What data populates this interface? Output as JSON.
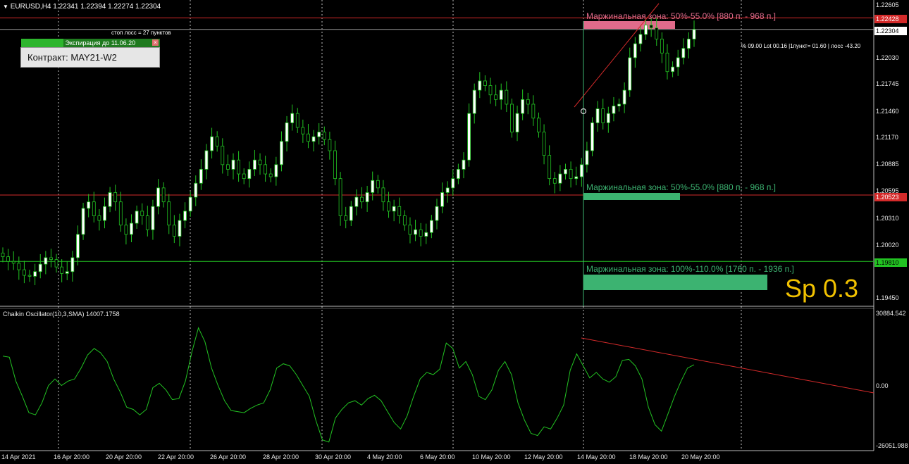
{
  "chart_header": {
    "symbol_line": "EURUSD,H4  1.22341 1.22394 1.22274 1.22304",
    "menu_glyph": "▼"
  },
  "overlay": {
    "stop_loss_text": "стоп лосс = 27 пунктов",
    "expiry_text": "Экспирация до 11.06.20",
    "contract_label": "Контракт: MAY21-W2",
    "spread_label": "Sp 0.3",
    "position_info": "% 09.00  Lot 00.16  |1пункт= 01.60  | лосс -43.20"
  },
  "zones": [
    {
      "label": "Маржинальная зона: 50%-55.0% [880 п. - 968 п.]",
      "color": "#e06b8b"
    },
    {
      "label": "Маржинальная зона: 50%-55.0% [880 п. - 968 п.]",
      "color": "#3cb371"
    },
    {
      "label": "Маржинальная зона: 100%-110.0% [1760 п. - 1936 п.]",
      "color": "#3cb371"
    }
  ],
  "price_axis": {
    "ticks": [
      "1.22605",
      "1.22030",
      "1.21745",
      "1.21460",
      "1.21170",
      "1.20885",
      "1.20595",
      "1.20310",
      "1.20020",
      "1.19450"
    ],
    "tags": [
      {
        "value": "1.22428",
        "bg": "#d42a2a",
        "fg": "#ffffff"
      },
      {
        "value": "1.22304",
        "bg": "#ffffff",
        "fg": "#000000"
      },
      {
        "value": "1.20523",
        "bg": "#d42a2a",
        "fg": "#ffffff"
      },
      {
        "value": "1.19810",
        "bg": "#22c322",
        "fg": "#000000"
      }
    ]
  },
  "oscillator": {
    "title": "Chaikin Oscillator(10,3,SMA) 14007.1758",
    "ticks": [
      "30884.542",
      "0.00",
      "-26051.988"
    ]
  },
  "time_axis": [
    "14 Apr 2021",
    "16 Apr 20:00",
    "20 Apr 20:00",
    "22 Apr 20:00",
    "26 Apr 20:00",
    "28 Apr 20:00",
    "30 Apr 20:00",
    "4 May 20:00",
    "6 May 20:00",
    "10 May 20:00",
    "12 May 20:00",
    "14 May 20:00",
    "18 May 20:00",
    "20 May 20:00"
  ],
  "colors": {
    "background": "#000000",
    "bull_candle": "#ffffff",
    "bear_candle": "#000000",
    "wick": "#22c322",
    "oscillator_line": "#22c322",
    "trend_line": "#d42a2a",
    "grid": "#ffffff",
    "spread_label": "#f2c200"
  },
  "chart_data": {
    "type": "candlestick",
    "symbol": "EURUSD",
    "timeframe": "H4",
    "ohlc_last": {
      "open": 1.22341,
      "high": 1.22394,
      "low": 1.22274,
      "close": 1.22304
    },
    "price_range": [
      1.1935,
      1.2262
    ],
    "horizontal_levels": [
      1.22428,
      1.22304,
      1.20523,
      1.1981
    ],
    "closes": [
      1.1986,
      1.1981,
      1.1979,
      1.1972,
      1.1966,
      1.1965,
      1.197,
      1.1978,
      1.1985,
      1.1983,
      1.1975,
      1.1968,
      1.197,
      1.1985,
      1.201,
      1.2038,
      1.2045,
      1.203,
      1.2025,
      1.204,
      1.2055,
      1.2045,
      1.202,
      1.201,
      1.2022,
      1.2035,
      1.203,
      1.2015,
      1.204,
      1.206,
      1.2045,
      1.202,
      1.2008,
      1.2025,
      1.2035,
      1.205,
      1.2065,
      1.208,
      1.21,
      1.2115,
      1.2105,
      1.2085,
      1.208,
      1.209,
      1.2075,
      1.207,
      1.208,
      1.209,
      1.2085,
      1.2075,
      1.2072,
      1.2085,
      1.211,
      1.213,
      1.214,
      1.2125,
      1.2118,
      1.211,
      1.2115,
      1.212,
      1.2112,
      1.21,
      1.207,
      1.203,
      1.2025,
      1.204,
      1.205,
      1.2045,
      1.2055,
      1.2068,
      1.206,
      1.2045,
      1.2035,
      1.204,
      1.203,
      1.202,
      1.201,
      1.2015,
      1.2008,
      1.2012,
      1.2025,
      1.204,
      1.2055,
      1.206,
      1.207,
      1.208,
      1.209,
      1.214,
      1.2165,
      1.2175,
      1.217,
      1.216,
      1.2155,
      1.2165,
      1.215,
      1.212,
      1.214,
      1.2155,
      1.215,
      1.2135,
      1.212,
      1.2095,
      1.207,
      1.2065,
      1.2075,
      1.208,
      1.207,
      1.2072,
      1.2085,
      1.21,
      1.213,
      1.2145,
      1.213,
      1.214,
      1.2148,
      1.215,
      1.2165,
      1.22,
      1.2215,
      1.2225,
      1.2235,
      1.2232,
      1.222,
      1.2205,
      1.2185,
      1.219,
      1.22,
      1.221,
      1.222,
      1.22304
    ]
  }
}
